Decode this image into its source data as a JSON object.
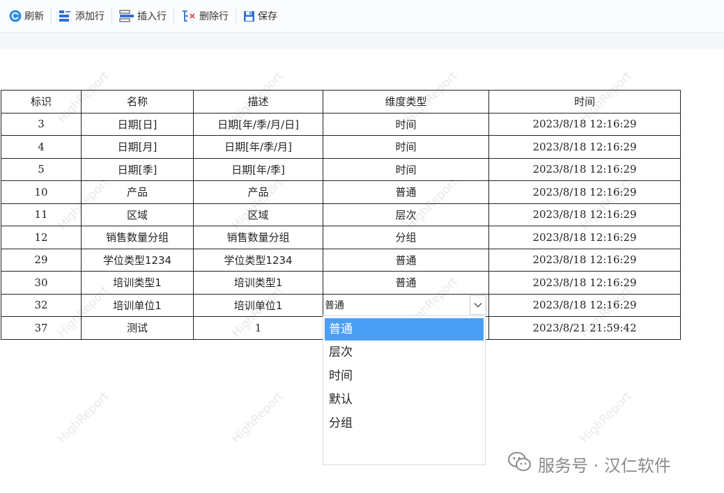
{
  "toolbar": {
    "refresh_label": "刷新",
    "add_row_label": "添加行",
    "insert_row_label": "插入行",
    "delete_row_label": "删除行",
    "save_label": "保存"
  },
  "table": {
    "columns": [
      "标识",
      "名称",
      "描述",
      "维度类型",
      "时间"
    ],
    "rows": [
      {
        "id": "3",
        "name": "日期[日]",
        "desc": "日期[年/季/月/日]",
        "type": "时间",
        "time": "2023/8/18 12:16:29"
      },
      {
        "id": "4",
        "name": "日期[月]",
        "desc": "日期[年/季/月]",
        "type": "时间",
        "time": "2023/8/18 12:16:29"
      },
      {
        "id": "5",
        "name": "日期[季]",
        "desc": "日期[年/季]",
        "type": "时间",
        "time": "2023/8/18 12:16:29"
      },
      {
        "id": "10",
        "name": "产品",
        "desc": "产品",
        "type": "普通",
        "time": "2023/8/18 12:16:29"
      },
      {
        "id": "11",
        "name": "区域",
        "desc": "区域",
        "type": "层次",
        "time": "2023/8/18 12:16:29"
      },
      {
        "id": "12",
        "name": "销售数量分组",
        "desc": "销售数量分组",
        "type": "分组",
        "time": "2023/8/18 12:16:29"
      },
      {
        "id": "29",
        "name": "学位类型1234",
        "desc": "学位类型1234",
        "type": "普通",
        "time": "2023/8/18 12:16:29"
      },
      {
        "id": "30",
        "name": "培训类型1",
        "desc": "培训类型1",
        "type": "普通",
        "time": "2023/8/18 12:16:29"
      },
      {
        "id": "32",
        "name": "培训单位1",
        "desc": "培训单位1",
        "type": "普通",
        "time": "2023/8/18 12:16:29"
      },
      {
        "id": "37",
        "name": "测试",
        "desc": "1",
        "type": "",
        "time": "2023/8/21 21:59:42"
      }
    ]
  },
  "dropdown": {
    "options": [
      "普通",
      "层次",
      "时间",
      "默认",
      "分组"
    ],
    "selected": "普通"
  },
  "watermark_text": "HighReport",
  "brand_text": "服务号 · 汉仁软件",
  "colors": {
    "accent_blue": "#2f7de1",
    "selected_option": "#4a9ff5",
    "delete_red": "#e04848"
  }
}
